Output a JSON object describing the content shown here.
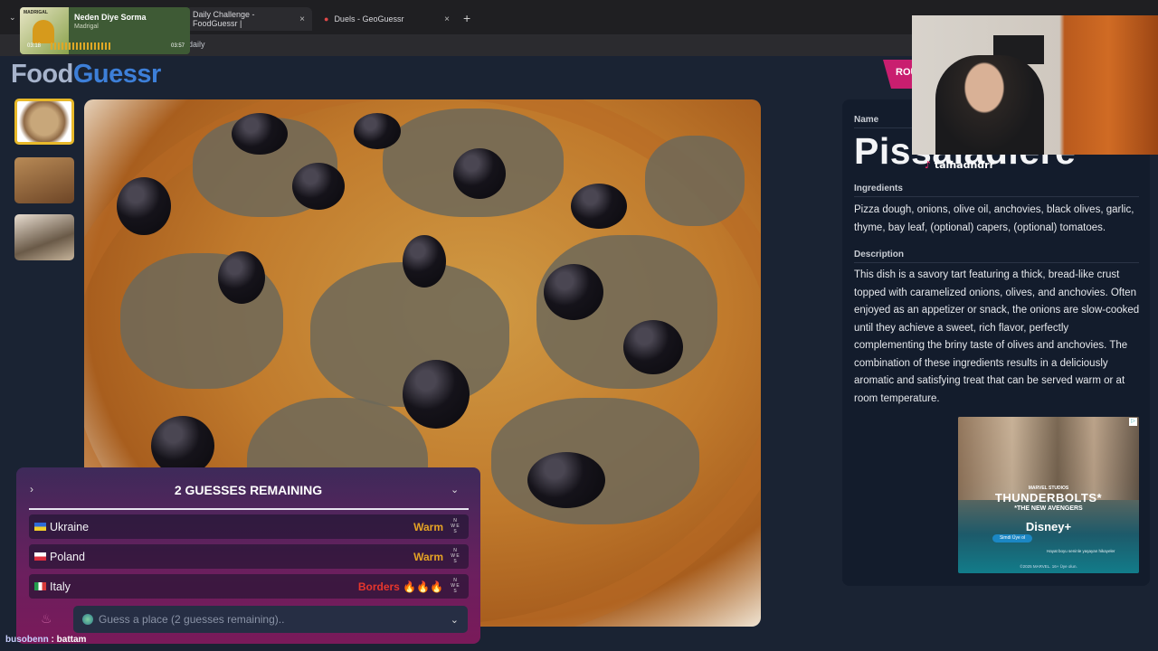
{
  "browser": {
    "tabs": [
      {
        "label": "Daily Challenge - FoodGuessr |",
        "active": true
      },
      {
        "label": "Duels - GeoGuessr",
        "active": false
      }
    ],
    "address_fragment": "daily",
    "new_tab": "+",
    "tab_close": "×"
  },
  "music": {
    "title": "Neden Diye Sorma",
    "artist": "Madrigal",
    "album_label": "MADRIGAL",
    "elapsed": "03:18",
    "total": "03:57"
  },
  "logo": {
    "part1": "Food",
    "part2": "Guessr"
  },
  "round_tab": "ROU",
  "dish": {
    "name_label": "Name",
    "name": "Pissaladière",
    "ingredients_label": "Ingredients",
    "ingredients": "Pizza dough, onions, olive oil, anchovies, black olives, garlic, thyme, bay leaf, (optional) capers, (optional) tomatoes.",
    "description_label": "Description",
    "description": "This dish is a savory tart featuring a thick, bread-like crust topped with caramelized onions, olives, and anchovies. Often enjoyed as an appetizer or snack, the onions are slow-cooked until they achieve a sweet, rich flavor, perfectly complementing the briny taste of olives and anchovies. The combination of these ingredients results in a deliciously aromatic and satisfying treat that can be served warm or at room temperature."
  },
  "ad": {
    "brand": "MARVEL STUDIOS",
    "title": "THUNDERBOLTS*",
    "subtitle": "*THE NEW AVENGERS",
    "service": "Disney+",
    "cta": "Simdi Üye ol",
    "tagline": "Hayat boyu seninle yaşayan hikayeler",
    "copyright": "©2025 MARVEL. 16+ Üye olun."
  },
  "webcam": {
    "handle": "talhadndrr"
  },
  "guesses": {
    "header": "2 GUESSES REMAINING",
    "rows": [
      {
        "country": "Ukraine",
        "status": "Warm",
        "status_color": "#e5a324"
      },
      {
        "country": "Poland",
        "status": "Warm",
        "status_color": "#e5a324"
      },
      {
        "country": "Italy",
        "status": "Borders 🔥🔥🔥",
        "status_color": "#e8362c"
      }
    ],
    "compass": "N\nW E\nS",
    "input_placeholder": "Guess a place (2 guesses remaining).."
  },
  "chat": {
    "user": "busobenn",
    "message": " : battam"
  }
}
